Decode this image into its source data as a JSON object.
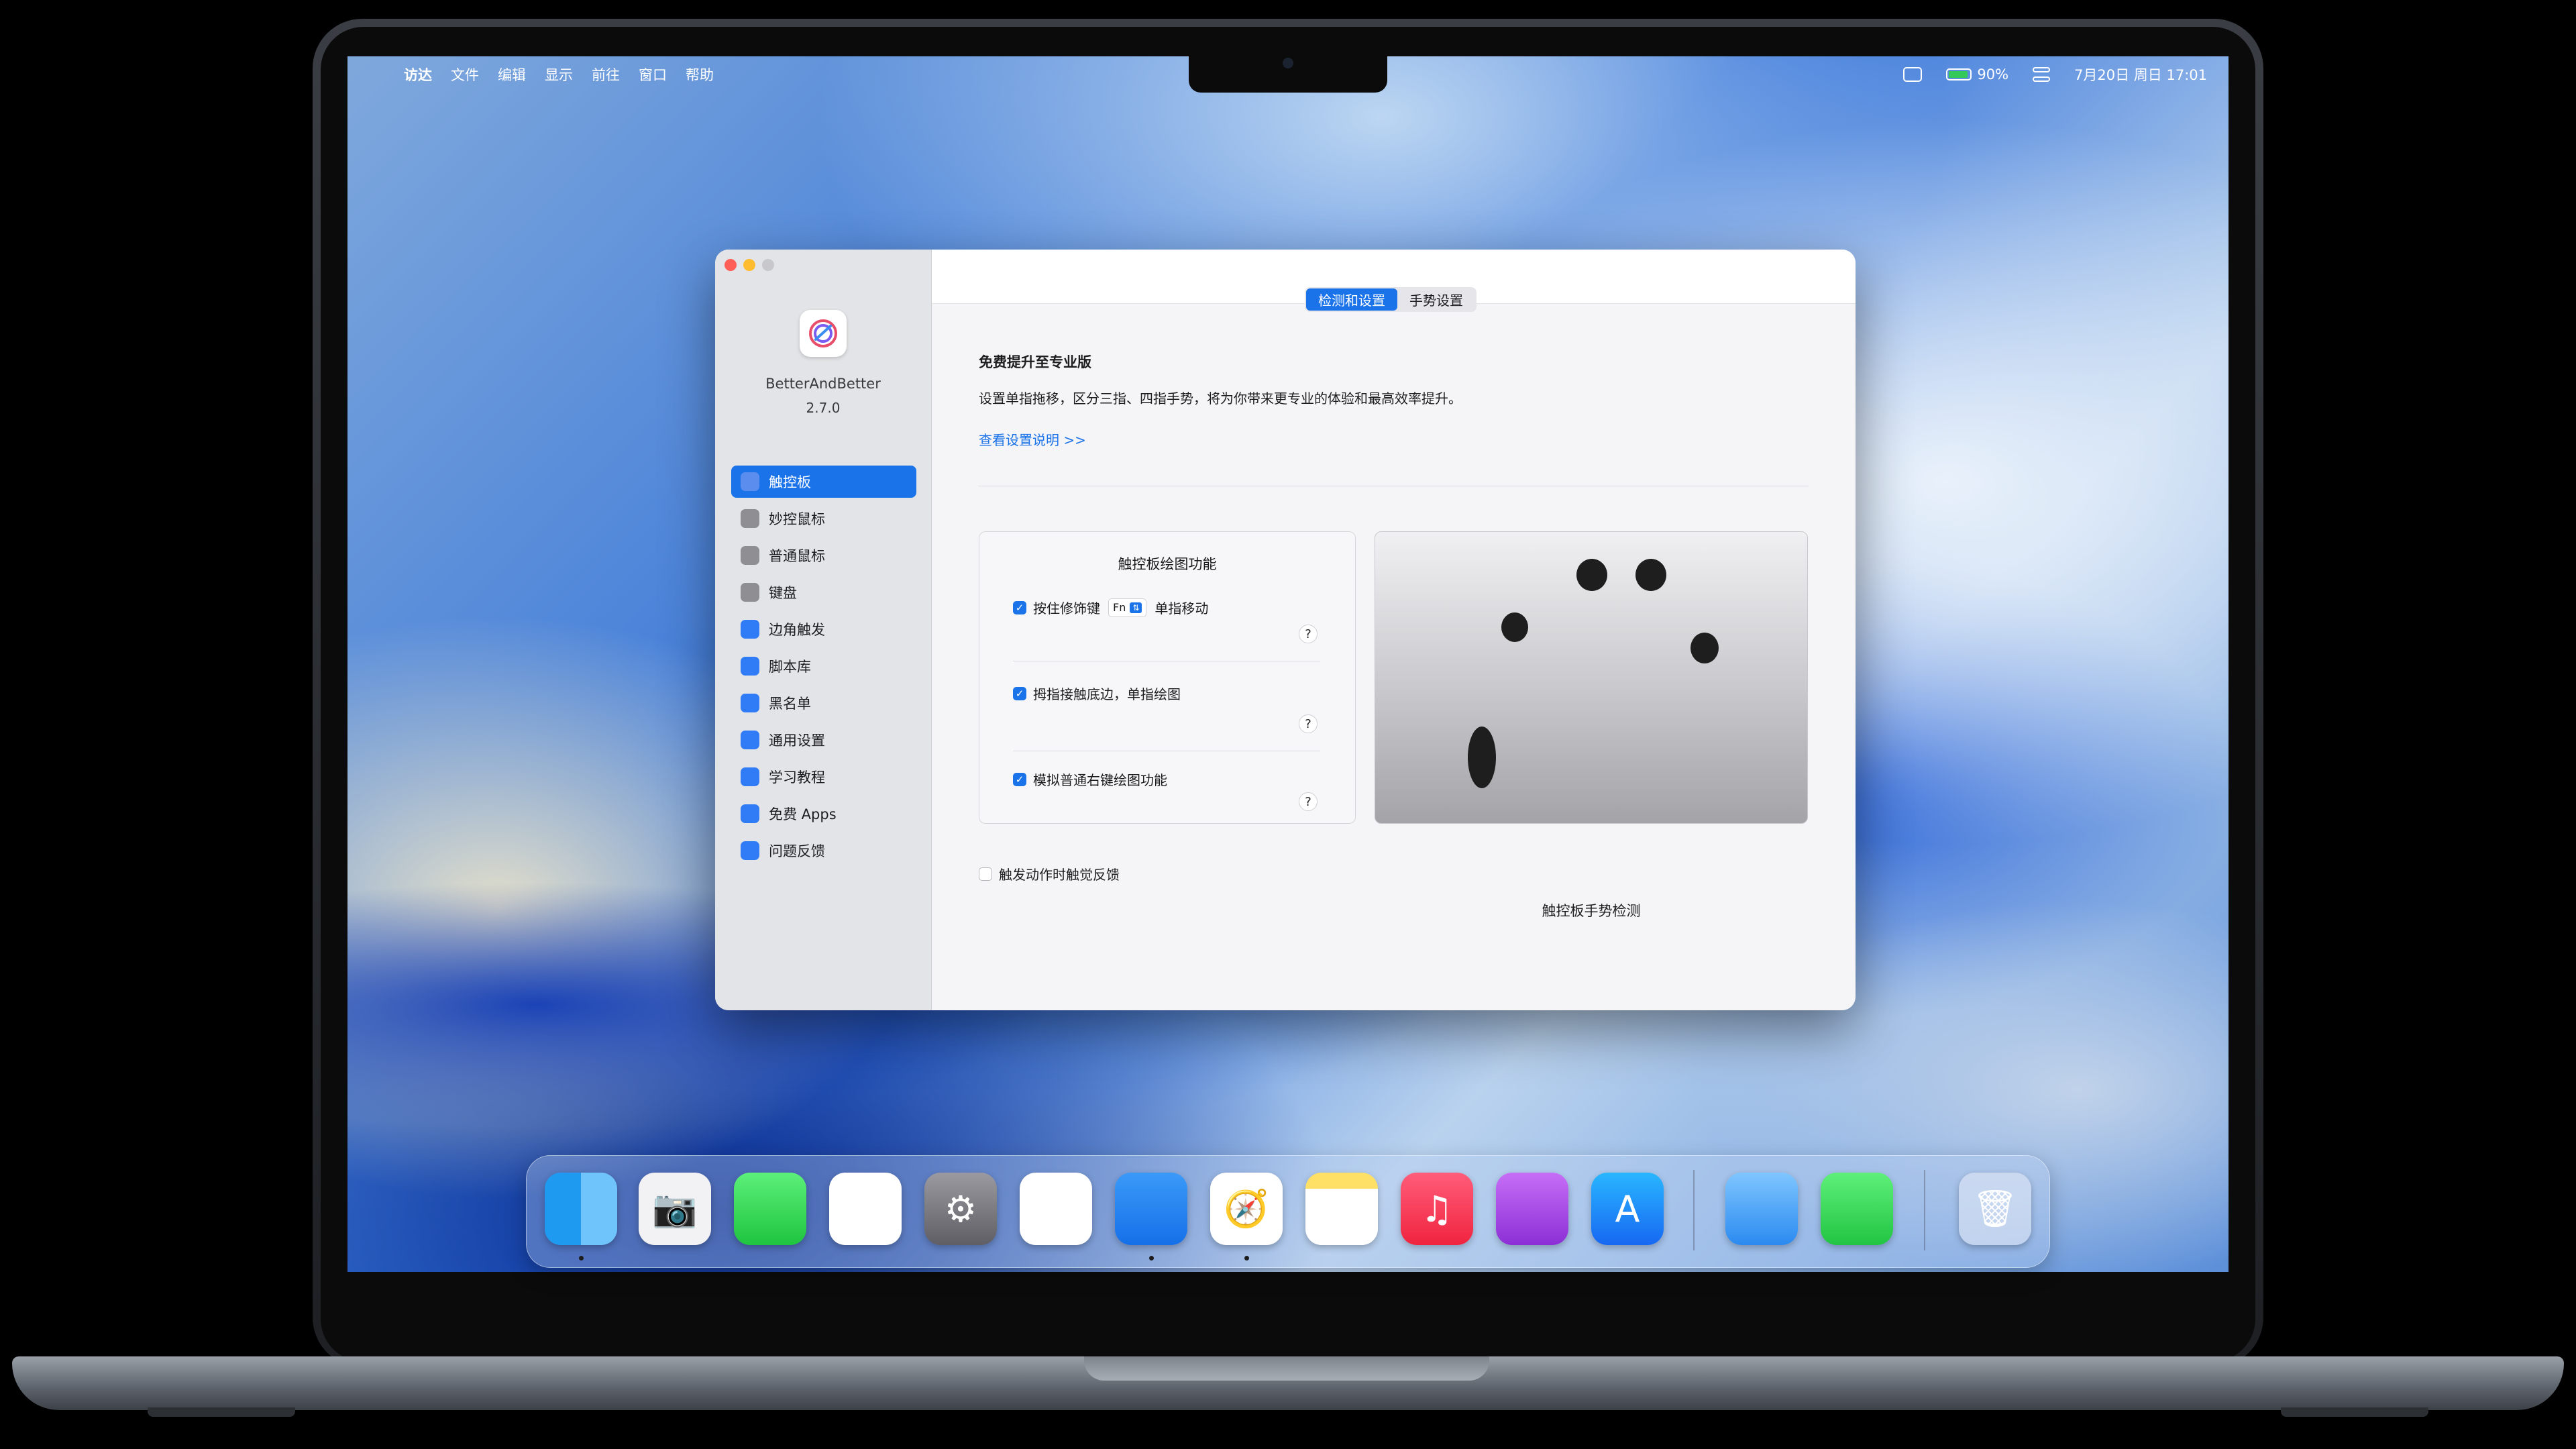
{
  "menubar": {
    "app": "访达",
    "items": [
      "文件",
      "编辑",
      "显示",
      "前往",
      "窗口",
      "帮助"
    ],
    "battery": "90%",
    "datetime": "7月20日 周日  17:01"
  },
  "window": {
    "app_name": "BetterAndBetter",
    "version": "2.7.0",
    "sidebar": [
      {
        "label": "触控板",
        "icon": "trackpad-icon",
        "color": "#5b8def"
      },
      {
        "label": "妙控鼠标",
        "icon": "magic-mouse-icon",
        "color": "#8e8e93"
      },
      {
        "label": "普通鼠标",
        "icon": "mouse-icon",
        "color": "#8e8e93"
      },
      {
        "label": "键盘",
        "icon": "keyboard-icon",
        "color": "#8e8e93"
      },
      {
        "label": "边角触发",
        "icon": "corner-trigger-icon",
        "color": "#2f7cf6"
      },
      {
        "label": "脚本库",
        "icon": "script-library-icon",
        "color": "#2f7cf6"
      },
      {
        "label": "黑名单",
        "icon": "blacklist-icon",
        "color": "#2f7cf6"
      },
      {
        "label": "通用设置",
        "icon": "general-settings-icon",
        "color": "#2f7cf6"
      },
      {
        "label": "学习教程",
        "icon": "tutorial-icon",
        "color": "#2f7cf6"
      },
      {
        "label": "免费 Apps",
        "icon": "free-apps-icon",
        "color": "#2f7cf6"
      },
      {
        "label": "问题反馈",
        "icon": "feedback-icon",
        "color": "#2f7cf6"
      }
    ],
    "tabs": [
      "检测和设置",
      "手势设置"
    ],
    "upgrade": {
      "title": "免费提升至专业版",
      "desc": "设置单指拖移，区分三指、四指手势，将为你带来更专业的体验和最高效率提升。",
      "link": "查看设置说明 >>"
    },
    "drawing": {
      "title": "触控板绘图功能",
      "opt1_prefix": "按住修饰键",
      "opt1_key": "Fn",
      "opt1_suffix": "单指移动",
      "opt2": "拇指接触底边，单指绘图",
      "opt3": "模拟普通右键绘图功能",
      "help": "?"
    },
    "haptic": "触发动作时触觉反馈",
    "trackpad_label": "触控板手势检测"
  },
  "dock": [
    "Finder",
    "Screenshot",
    "FaceTime",
    "Photos",
    "System Settings",
    "Reminders",
    "Keynote",
    "Safari",
    "Notes",
    "Music",
    "Podcasts",
    "App Store",
    "BetterAndBetter",
    "Battery",
    "Trash"
  ]
}
